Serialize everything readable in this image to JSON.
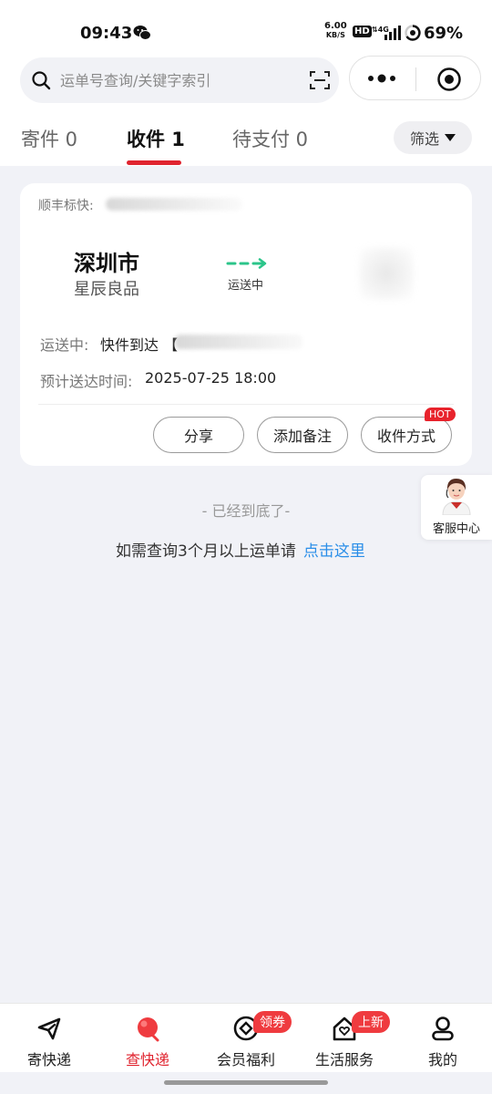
{
  "status_bar": {
    "time": "09:43",
    "net_speed_value": "6.00",
    "net_speed_unit": "KB/S",
    "hd": "HD",
    "battery": "69%"
  },
  "search": {
    "placeholder": "运单号查询/关键字索引"
  },
  "tabs": [
    {
      "label": "寄件 0"
    },
    {
      "label": "收件 1"
    },
    {
      "label": "待支付 0"
    }
  ],
  "filter_label": "筛选",
  "card": {
    "carrier": "顺丰标快: ",
    "from_city": "深圳市",
    "from_name": "星辰良品",
    "route_status": "运送中",
    "status_label": "运送中:",
    "status_value": "快件到达 【",
    "eta_label": "预计送达时间:",
    "eta_value": "2025-07-25 18:00",
    "buttons": {
      "share": "分享",
      "note": "添加备注",
      "receive_method": "收件方式"
    },
    "hot_badge": "HOT"
  },
  "end_text": "- 已经到底了-",
  "query_text": "如需查询3个月以上运单请",
  "query_link": "点击这里",
  "customer_service": "客服中心",
  "nav": [
    {
      "label": "寄快递",
      "icon": "send-icon"
    },
    {
      "label": "查快递",
      "icon": "track-icon"
    },
    {
      "label": "会员福利",
      "icon": "member-icon",
      "badge": "领券"
    },
    {
      "label": "生活服务",
      "icon": "home-service-icon",
      "badge": "上新"
    },
    {
      "label": "我的",
      "icon": "profile-icon"
    }
  ],
  "colors": {
    "accent": "#e0242f",
    "link": "#2a8ee8",
    "route_arrow": "#2cc58a"
  }
}
